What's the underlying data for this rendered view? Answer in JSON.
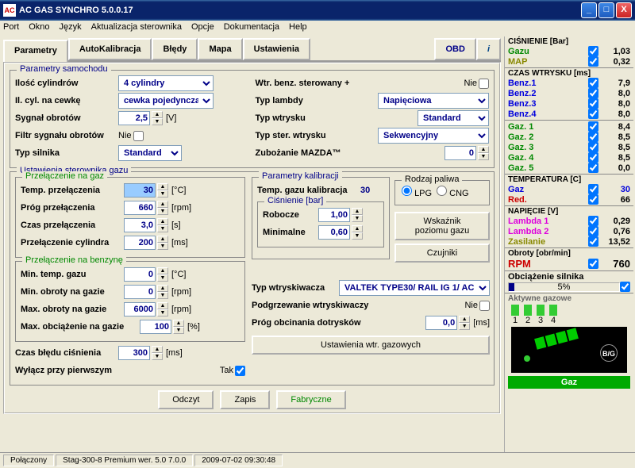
{
  "window": {
    "title": "AC GAS SYNCHRO  5.0.0.17"
  },
  "menu": [
    "Port",
    "Okno",
    "Język",
    "Aktualizacja sterownika",
    "Opcje",
    "Dokumentacja",
    "Help"
  ],
  "tabs": {
    "items": [
      "Parametry",
      "AutoKalibracja",
      "Błędy",
      "Mapa",
      "Ustawienia"
    ],
    "obd": "OBD"
  },
  "car": {
    "title": "Parametry samochodu",
    "ilosc_cyl_lbl": "Ilość cylindrów",
    "ilosc_cyl": "4 cylindry",
    "il_cewka_lbl": "Il. cyl. na cewkę",
    "il_cewka": "cewka pojedyncza",
    "sygnal_lbl": "Sygnał obrotów",
    "sygnal": "2,5",
    "sygnal_unit": "[V]",
    "filtr_lbl": "Filtr sygnału obrotów",
    "filtr_chk": "Nie",
    "typ_silnika_lbl": "Typ silnika",
    "typ_silnika": "Standard",
    "wtr_benz_lbl": "Wtr. benz. sterowany +",
    "wtr_benz_chk": "Nie",
    "typ_lambdy_lbl": "Typ lambdy",
    "typ_lambdy": "Napięciowa",
    "typ_wtrysku_lbl": "Typ wtrysku",
    "typ_wtrysku": "Standard",
    "typ_ster_lbl": "Typ ster. wtrysku",
    "typ_ster": "Sekwencyjny",
    "zuboz_lbl": "Zubożanie MAZDA™",
    "zuboz": "0"
  },
  "gas": {
    "title": "Ustawienia sterownika gazu",
    "na_gaz_title": "Przełączenie na gaz",
    "temp_lbl": "Temp. przełączenia",
    "temp": "30",
    "temp_unit": "[°C]",
    "prog_lbl": "Próg przełączenia",
    "prog": "660",
    "prog_unit": "[rpm]",
    "czas_lbl": "Czas przełączenia",
    "czas": "3,0",
    "czas_unit": "[s]",
    "przel_cyl_lbl": "Przełączenie cylindra",
    "przel_cyl": "200",
    "przel_cyl_unit": "[ms]",
    "na_benz_title": "Przełączenie na benzynę",
    "min_temp_lbl": "Min. temp. gazu",
    "min_temp": "0",
    "min_temp_unit": "[°C]",
    "min_obr_lbl": "Min. obroty na gazie",
    "min_obr": "0",
    "min_obr_unit": "[rpm]",
    "max_obr_lbl": "Max. obroty na gazie",
    "max_obr": "6000",
    "max_obr_unit": "[rpm]",
    "max_obc_lbl": "Max. obciążenie na gazie",
    "max_obc": "100",
    "max_obc_unit": "[%]",
    "czas_bledu_lbl": "Czas błędu ciśnienia",
    "czas_bledu": "300",
    "czas_bledu_unit": "[ms]",
    "wylacz_lbl": "Wyłącz przy pierwszym",
    "wylacz_chk": "Tak"
  },
  "kalib": {
    "title": "Parametry kalibracji",
    "temp_lbl": "Temp. gazu kalibracja",
    "temp": "30",
    "cis_title": "Ciśnienie [bar]",
    "rob_lbl": "Robocze",
    "rob": "1,00",
    "min_lbl": "Minimalne",
    "min": "0,60",
    "paliwo_title": "Rodzaj paliwa",
    "lpg": "LPG",
    "cng": "CNG",
    "wskaznik_btn": "Wskaźnik poziomu gazu",
    "czujniki_btn": "Czujniki"
  },
  "wtr": {
    "typ_lbl": "Typ wtryskiwacza",
    "typ": "VALTEK TYPE30/ RAIL IG 1/ AC",
    "podgrz_lbl": "Podgrzewanie wtryskiwaczy",
    "podgrz_chk": "Nie",
    "prog_lbl": "Próg obcinania dotrysków",
    "prog": "0,0",
    "prog_unit": "[ms]",
    "ust_btn": "Ustawienia wtr. gazowych"
  },
  "bottom": {
    "odczyt": "Odczyt",
    "zapis": "Zapis",
    "fabryczne": "Fabryczne"
  },
  "side": {
    "cis_hdr": "CIŚNIENIE [Bar]",
    "gazu_lbl": "Gazu",
    "gazu": "1,03",
    "map_lbl": "MAP",
    "map": "0,32",
    "czasw_hdr": "CZAS WTRYSKU  [ms]",
    "benz": [
      {
        "lbl": "Benz.1",
        "v": "7,9"
      },
      {
        "lbl": "Benz.2",
        "v": "8,0"
      },
      {
        "lbl": "Benz.3",
        "v": "8,0"
      },
      {
        "lbl": "Benz.4",
        "v": "8,0"
      }
    ],
    "gaz": [
      {
        "lbl": "Gaz. 1",
        "v": "8,4"
      },
      {
        "lbl": "Gaz. 2",
        "v": "8,5"
      },
      {
        "lbl": "Gaz. 3",
        "v": "8,5"
      },
      {
        "lbl": "Gaz. 4",
        "v": "8,5"
      },
      {
        "lbl": "Gaz. 5",
        "v": "0,0"
      }
    ],
    "temp_hdr": "TEMPERATURA  [C]",
    "gaz_t_lbl": "Gaz",
    "gaz_t": "30",
    "red_lbl": "Red.",
    "red": "66",
    "nap_hdr": "NAPIĘCIE [V]",
    "l1_lbl": "Lambda 1",
    "l1": "0,29",
    "l2_lbl": "Lambda 2",
    "l2": "0,76",
    "zas_lbl": "Zasilanie",
    "zas": "13,52",
    "obr_hdr": "Obroty [obr/min]",
    "rpm_lbl": "RPM",
    "rpm": "760",
    "obc_hdr": "Obciążenie silnika",
    "obc": "5%",
    "akt_hdr": "Aktywne gazowe",
    "inj_nums": [
      "1",
      "2",
      "3",
      "4"
    ],
    "gaz_status": "Gaz",
    "bg": "B/G"
  },
  "status": {
    "conn": "Połączony",
    "ver": "Stag-300-8 Premium   wer. 5.0  7.0.0",
    "date": "2009-07-02 09:30:48"
  }
}
